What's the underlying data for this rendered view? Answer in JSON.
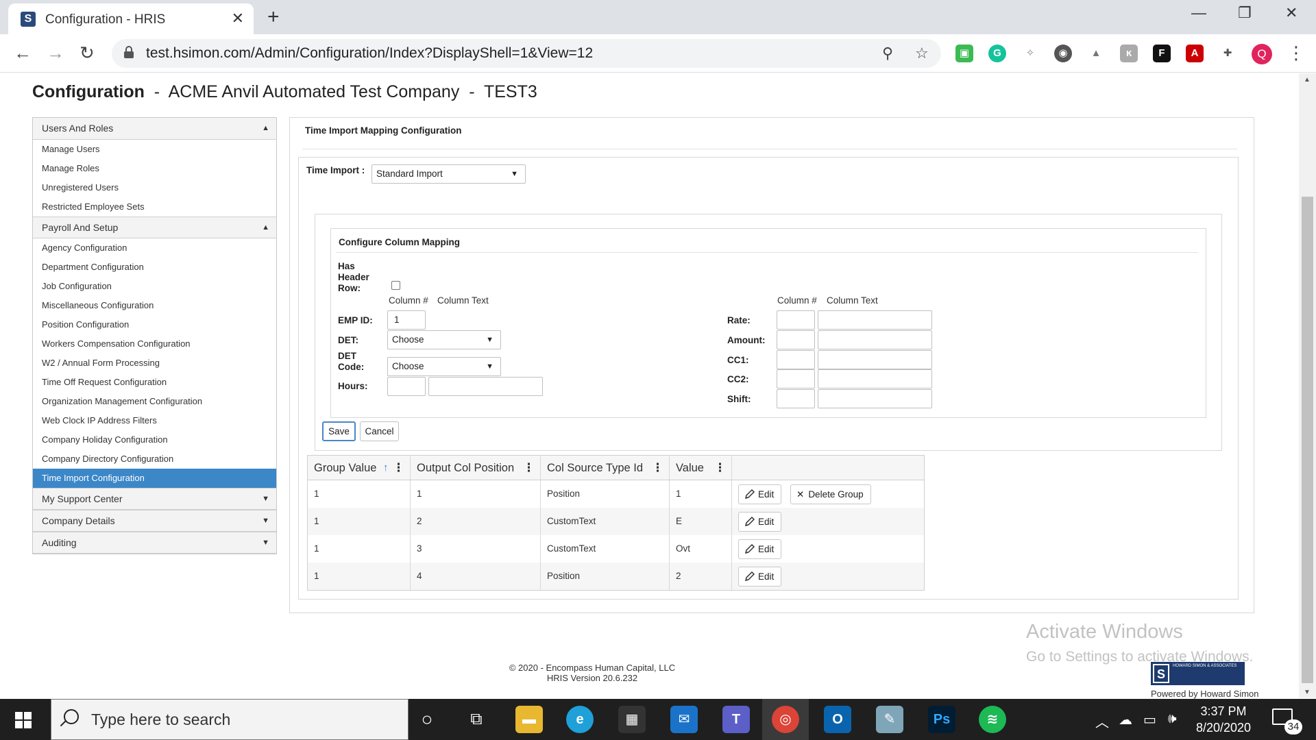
{
  "browser": {
    "tab_title": "Configuration - HRIS",
    "tab_favicon_letter": "S",
    "url": "test.hsimon.com/Admin/Configuration/Index?DisplayShell=1&View=12",
    "profile_initial": "Q"
  },
  "page": {
    "title_bold": "Configuration",
    "title_rest": "  -  ACME Anvil Automated Test Company  -  TEST3"
  },
  "sidebar": {
    "sections": [
      {
        "label": "Users And Roles",
        "expanded": true,
        "items": [
          "Manage Users",
          "Manage Roles",
          "Unregistered Users",
          "Restricted Employee Sets"
        ]
      },
      {
        "label": "Payroll And Setup",
        "expanded": true,
        "items": [
          "Agency Configuration",
          "Department Configuration",
          "Job Configuration",
          "Miscellaneous Configuration",
          "Position Configuration",
          "Workers Compensation Configuration",
          "W2 / Annual Form Processing",
          "Time Off Request Configuration",
          "Organization Management Configuration",
          "Web Clock IP Address Filters",
          "Company Holiday Configuration",
          "Company Directory Configuration",
          "Time Import Configuration"
        ]
      },
      {
        "label": "My Support Center",
        "expanded": false,
        "items": []
      },
      {
        "label": "Company Details",
        "expanded": false,
        "items": []
      },
      {
        "label": "Auditing",
        "expanded": false,
        "items": []
      }
    ],
    "active_item": "Time Import Configuration"
  },
  "panel": {
    "title": "Time Import Mapping Configuration",
    "time_import_label": "Time Import :",
    "time_import_value": "Standard Import",
    "mapping": {
      "title": "Configure Column Mapping",
      "has_header_label": "Has Header Row:",
      "has_header_checked": false,
      "col_num_header": "Column #",
      "col_text_header": "Column Text",
      "emp_id_label": "EMP ID:",
      "emp_id_value": "1",
      "det_label": "DET:",
      "det_value": "Choose",
      "det_code_label": "DET Code:",
      "det_code_value": "Choose",
      "hours_label": "Hours:",
      "rate_label": "Rate:",
      "amount_label": "Amount:",
      "cc1_label": "CC1:",
      "cc2_label": "CC2:",
      "shift_label": "Shift:"
    },
    "save_label": "Save",
    "cancel_label": "Cancel"
  },
  "grid": {
    "columns": [
      "Group Value",
      "Output Col Position",
      "Col Source Type Id",
      "Value"
    ],
    "sort_column": "Group Value",
    "sort_indicator": "↑",
    "edit_label": "Edit",
    "delete_label": "Delete Group",
    "rows": [
      {
        "group": "1",
        "position": "1",
        "source": "Position",
        "value": "1",
        "has_delete": true
      },
      {
        "group": "1",
        "position": "2",
        "source": "CustomText",
        "value": "E",
        "has_delete": false
      },
      {
        "group": "1",
        "position": "3",
        "source": "CustomText",
        "value": "Ovt",
        "has_delete": false
      },
      {
        "group": "1",
        "position": "4",
        "source": "Position",
        "value": "2",
        "has_delete": false
      }
    ]
  },
  "footer": {
    "copyright": "© 2020 - Encompass Human Capital, LLC",
    "version": "HRIS Version 20.6.232"
  },
  "watermark": {
    "line1": "Activate Windows",
    "line2": "Go to Settings to activate Windows."
  },
  "branding": {
    "logo_text": "HOWARD SIMON & ASSOCIATES",
    "powered_by": "Powered by Howard Simon"
  },
  "taskbar": {
    "search_placeholder": "Type here to search",
    "time": "3:37 PM",
    "date": "8/20/2020",
    "notification_count": "34"
  },
  "colors": {
    "accent": "#3b87c8",
    "taskbar": "#1f1f1f"
  }
}
